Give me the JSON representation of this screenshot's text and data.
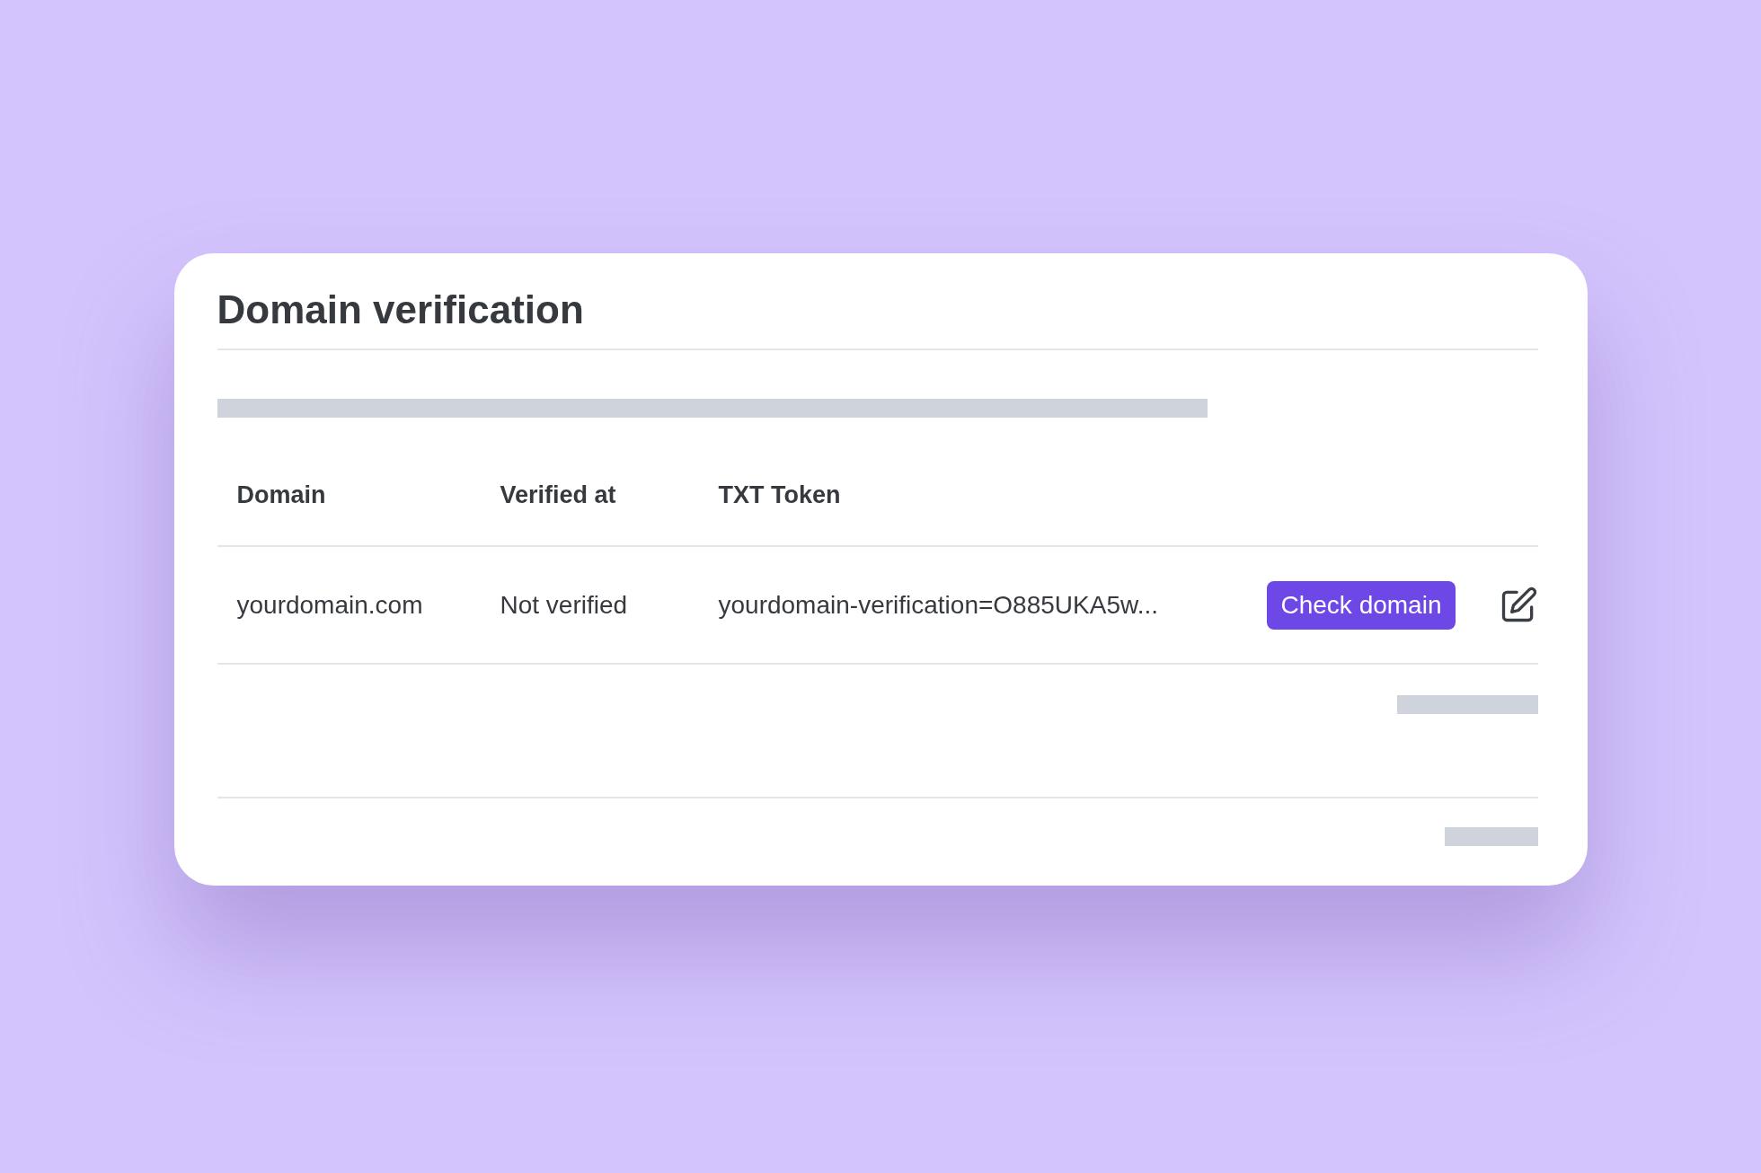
{
  "card": {
    "title": "Domain verification"
  },
  "table": {
    "columns": [
      "Domain",
      "Verified at",
      "TXT Token"
    ],
    "rows": [
      {
        "domain": "yourdomain.com",
        "verified_at": "Not verified",
        "txt_token": "yourdomain-verification=O885UKA5w...",
        "action": "Check domain"
      }
    ]
  }
}
